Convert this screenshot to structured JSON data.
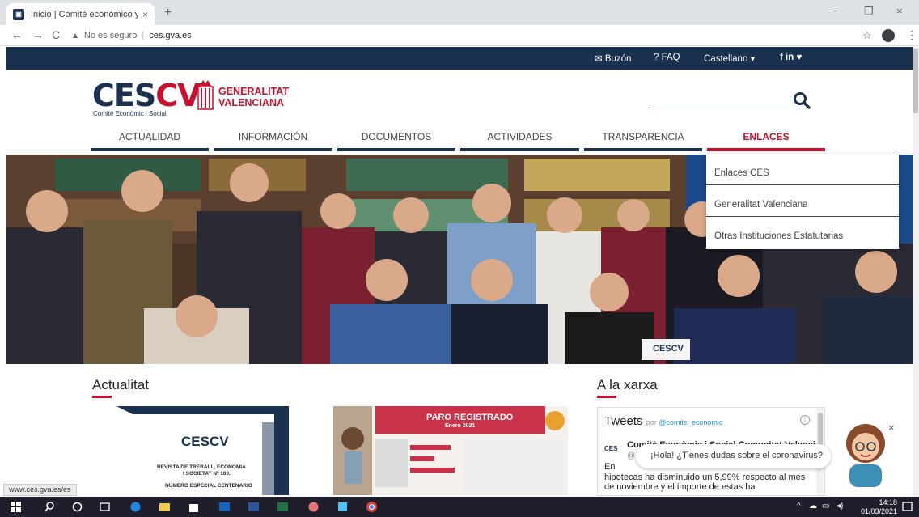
{
  "browser": {
    "tab_title": "Inicio | Comité económico y social",
    "tab_close": "×",
    "new_tab": "+",
    "back": "←",
    "forward": "→",
    "reload": "C",
    "not_secure": "No es seguro",
    "host": "ces.gva.es",
    "status_url": "www.ces.gva.es/es",
    "window_minimize": "−",
    "window_restore": "❐",
    "window_close": "×"
  },
  "topbar": {
    "mailbox": "✉ Buzón",
    "faq": "? FAQ",
    "language": "Castellano ▾",
    "social": "f  in  ♥"
  },
  "header": {
    "logo_part1": "CES",
    "logo_part2": "CV",
    "logo_subtitle": "Comitè Econòmic i Social",
    "gv_line1": "GENERALITAT",
    "gv_line2": "VALENCIANA"
  },
  "nav": {
    "items": [
      {
        "label": "ACTUALIDAD"
      },
      {
        "label": "INFORMACIÓN"
      },
      {
        "label": "DOCUMENTOS"
      },
      {
        "label": "ACTIVIDADES"
      },
      {
        "label": "TRANSPARENCIA"
      },
      {
        "label": "ENLACES"
      }
    ]
  },
  "dropdown": {
    "items": [
      {
        "label": "Enlaces CES"
      },
      {
        "label": "Generalitat Valenciana"
      },
      {
        "label": "Otras Instituciones Estatutarias"
      }
    ]
  },
  "hero": {
    "table_sign": "CESCV"
  },
  "actualitat": {
    "title": "Actualitat",
    "card1_logo": "CESCV",
    "card1_line1": "REVISTA DE TREBALL, ECONOMIA",
    "card1_line2": "I SOCIETAT Nº 100.",
    "card1_line3": "NÚMERO ESPECIAL CENTENARIO",
    "card2_title": "PARO REGISTRADO",
    "card2_subtitle": "Enero 2021"
  },
  "xarxa": {
    "title": "A la xarxa",
    "tweets": "Tweets",
    "by": "por",
    "handle": "@comite_economic",
    "info": "i",
    "tweet_author": "Comitè Econòmic i Social Comunitat Valenciana",
    "tweet_handle": "@",
    "tweet_en": "En",
    "tweet_text": "hipotecas ha disminuido un 5,99% respecto al mes de noviembre y el importe de estas ha"
  },
  "chat": {
    "bubble": "¡Hola! ¿Tienes dudas sobre el coronavirus?",
    "close": "×"
  },
  "taskbar": {
    "time": "14:18",
    "date": "01/03/2021"
  }
}
